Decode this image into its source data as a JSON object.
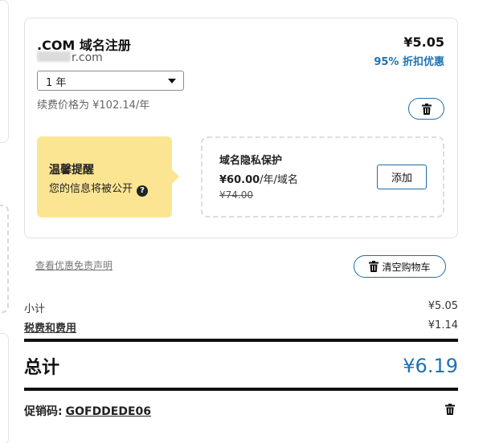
{
  "cart_item": {
    "product_name": ".COM 域名注册",
    "domain_suffix": "r.com",
    "price": "¥5.05",
    "discount": "95% 折扣优惠",
    "term_select": {
      "selected": "1 年"
    },
    "renewal_price": "续费价格为 ¥102.14/年",
    "delete_icon": "trash-icon"
  },
  "alert": {
    "title": "温馨提醒",
    "text": "您的信息将被公开",
    "help_icon": "question-circle-icon",
    "help_glyph": "?"
  },
  "privacy": {
    "title": "域名隐私保护",
    "price": "¥60.00",
    "unit": "/年/域名",
    "old_price": "¥74.00",
    "add_label": "添加"
  },
  "links": {
    "disclaimer": "查看优惠免责声明"
  },
  "clear_cart": {
    "label": "清空购物车",
    "icon": "trash-icon"
  },
  "summary": {
    "subtotal_label": "小计",
    "subtotal_value": "¥5.05",
    "tax_label": "税费和费用",
    "tax_value": "¥1.14",
    "total_label": "总计",
    "total_value": "¥6.19"
  },
  "promo": {
    "label": "促销码:",
    "code": "GOFDDEDE06",
    "delete_icon": "trash-icon"
  },
  "colors": {
    "accent": "#1d73b5",
    "alert_bg": "#fce592",
    "button_border": "#1d6ea8"
  }
}
